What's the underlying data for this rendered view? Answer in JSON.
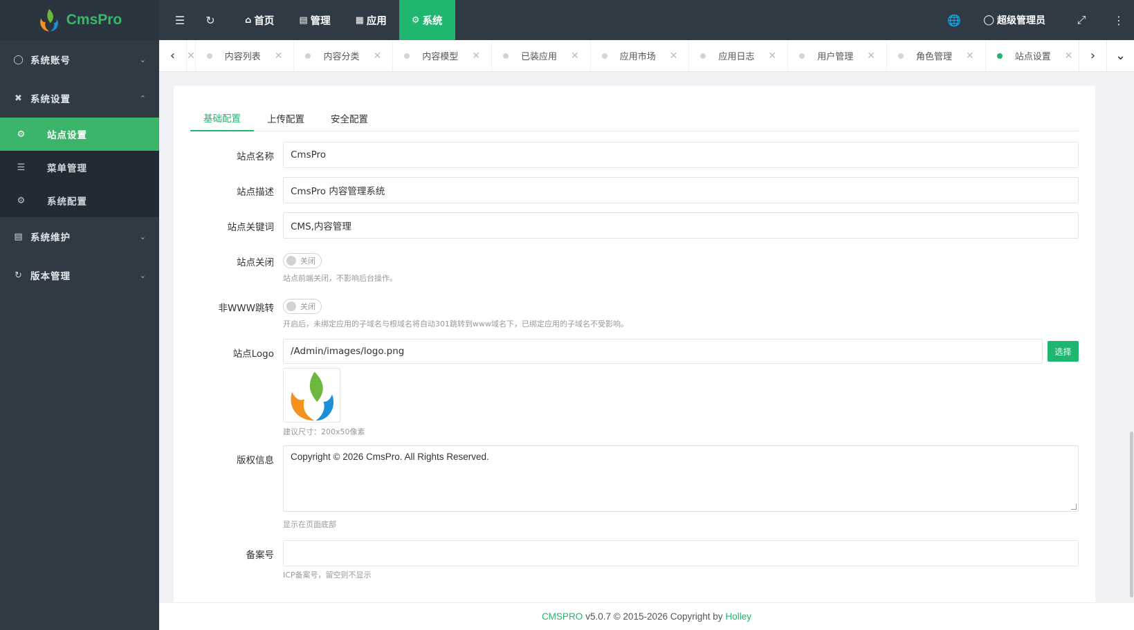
{
  "brand": {
    "name": "CmsPro"
  },
  "sidebar": {
    "groups": [
      {
        "label": "系统账号"
      },
      {
        "label": "系统设置",
        "items": [
          {
            "label": "站点设置"
          },
          {
            "label": "菜单管理"
          },
          {
            "label": "系统配置"
          }
        ]
      },
      {
        "label": "系统维护"
      },
      {
        "label": "版本管理"
      }
    ]
  },
  "header": {
    "menus": [
      "首页",
      "管理",
      "应用",
      "系统"
    ],
    "active_menu": "系统",
    "user": "超级管理员"
  },
  "tabs": [
    "内容列表",
    "内容分类",
    "内容模型",
    "已装应用",
    "应用市场",
    "应用日志",
    "用户管理",
    "角色管理",
    "站点设置"
  ],
  "active_tab": "站点设置",
  "form": {
    "tabs": [
      "基础配置",
      "上传配置",
      "安全配置"
    ],
    "site_name": {
      "label": "站点名称",
      "value": "CmsPro"
    },
    "site_desc": {
      "label": "站点描述",
      "value": "CmsPro 内容管理系统"
    },
    "site_keywords": {
      "label": "站点关键词",
      "value": "CMS,内容管理"
    },
    "site_close": {
      "label": "站点关闭",
      "switch_text": "关闭",
      "hint": "站点前端关闭，不影响后台操作。"
    },
    "www_redirect": {
      "label": "非WWW跳转",
      "switch_text": "关闭",
      "hint": "开启后，未绑定应用的子域名与根域名将自动301跳转到www域名下，已绑定应用的子域名不受影响。"
    },
    "site_logo": {
      "label": "站点Logo",
      "value": "/Admin/images/logo.png",
      "button": "选择",
      "hint": "建议尺寸：200x50像素"
    },
    "copyright": {
      "label": "版权信息",
      "value": "Copyright © 2026 CmsPro. All Rights Reserved.",
      "hint": "显示在页面底部"
    },
    "icp": {
      "label": "备案号",
      "value": "",
      "hint": "ICP备案号，留空则不显示"
    }
  },
  "footer": {
    "brand": "CMSPRO",
    "text": "v5.0.7 © 2015-2026 Copyright by",
    "author": "Holley"
  },
  "colors": {
    "accent": "#1fb76f",
    "sidebar": "#2f3a45",
    "sidebar_active": "#3ab56a"
  }
}
